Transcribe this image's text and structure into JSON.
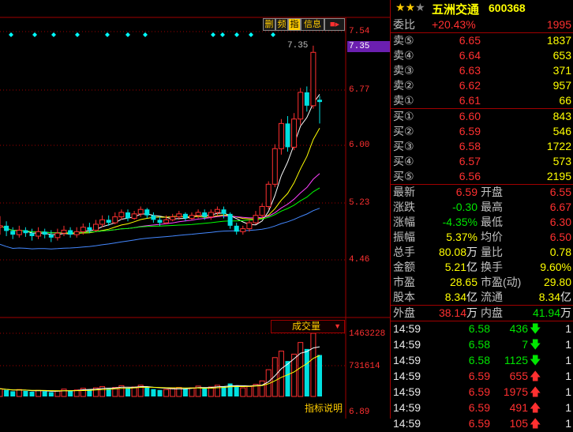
{
  "header": {
    "stars": 3,
    "stock_name": "五洲交通",
    "stock_code": "600368"
  },
  "toolbar": {
    "btn1": "删",
    "btn2": "频",
    "btn3": "指",
    "btn4": "信息"
  },
  "price_axis": {
    "ticks": [
      "7.54",
      "6.77",
      "6.00",
      "5.23",
      "4.46"
    ],
    "current": "7.35"
  },
  "chart_annotation": {
    "high_label": "7.35"
  },
  "volume_panel": {
    "title": "成交量",
    "ticks": [
      "1463228",
      "731614"
    ],
    "footer_label": "指标说明",
    "bottom_tick": "6.89"
  },
  "order_book": {
    "weibi_label": "委比",
    "weibi_pct": "+20.43%",
    "weibi_val": "1995",
    "asks": [
      {
        "label": "卖⑤",
        "price": "6.65",
        "qty": "1837"
      },
      {
        "label": "卖④",
        "price": "6.64",
        "qty": "653"
      },
      {
        "label": "卖③",
        "price": "6.63",
        "qty": "371"
      },
      {
        "label": "卖②",
        "price": "6.62",
        "qty": "957"
      },
      {
        "label": "卖①",
        "price": "6.61",
        "qty": "66"
      }
    ],
    "bids": [
      {
        "label": "买①",
        "price": "6.60",
        "qty": "843"
      },
      {
        "label": "买②",
        "price": "6.59",
        "qty": "546"
      },
      {
        "label": "买③",
        "price": "6.58",
        "qty": "1722"
      },
      {
        "label": "买④",
        "price": "6.57",
        "qty": "573"
      },
      {
        "label": "买⑤",
        "price": "6.56",
        "qty": "2195"
      }
    ]
  },
  "quote": [
    {
      "l1": "最新",
      "v1": "6.59",
      "u1": "",
      "l2": "开盘",
      "v2": "6.55"
    },
    {
      "l1": "涨跌",
      "v1": "-0.30",
      "u1": "",
      "l2": "最高",
      "v2": "6.67"
    },
    {
      "l1": "涨幅",
      "v1": "-4.35%",
      "u1": "",
      "l2": "最低",
      "v2": "6.30"
    },
    {
      "l1": "振幅",
      "v1": "5.37%",
      "u1": "",
      "l2": "均价",
      "v2": "6.50"
    },
    {
      "l1": "总手",
      "v1": "80.08",
      "u1": "万",
      "l2": "量比",
      "v2": "0.78"
    },
    {
      "l1": "金额",
      "v1": "5.21",
      "u1": "亿",
      "l2": "换手",
      "v2": "9.60%"
    },
    {
      "l1": "市盈",
      "v1": "28.65",
      "u1": "",
      "l2": "市盈(动)",
      "v2": "29.80"
    },
    {
      "l1": "股本",
      "v1": "8.34",
      "u1": "亿",
      "l2": "流通",
      "v2": "8.34",
      "u2": "亿"
    },
    {
      "l1": "外盘",
      "v1": "38.14",
      "u1": "万",
      "l2": "内盘",
      "v2": "41.94",
      "u2": "万"
    }
  ],
  "ticks": [
    {
      "time": "14:59",
      "price": "6.58",
      "vol": "436",
      "dir": "down",
      "n": "1"
    },
    {
      "time": "14:59",
      "price": "6.58",
      "vol": "7",
      "dir": "down",
      "n": "1"
    },
    {
      "time": "14:59",
      "price": "6.58",
      "vol": "1125",
      "dir": "down",
      "n": "1"
    },
    {
      "time": "14:59",
      "price": "6.59",
      "vol": "655",
      "dir": "up",
      "n": "1"
    },
    {
      "time": "14:59",
      "price": "6.59",
      "vol": "1975",
      "dir": "up",
      "n": "1"
    },
    {
      "time": "14:59",
      "price": "6.59",
      "vol": "491",
      "dir": "up",
      "n": "1"
    },
    {
      "time": "14:59",
      "price": "6.59",
      "vol": "105",
      "dir": "up",
      "n": "1"
    }
  ],
  "candles": [
    [
      4.9,
      4.92,
      4.8,
      5.05
    ],
    [
      4.92,
      4.85,
      4.78,
      4.98
    ],
    [
      4.85,
      4.8,
      4.74,
      4.9
    ],
    [
      4.8,
      4.86,
      4.76,
      4.92
    ],
    [
      4.86,
      4.82,
      4.77,
      4.9
    ],
    [
      4.82,
      4.78,
      4.72,
      4.88
    ],
    [
      4.78,
      4.84,
      4.74,
      4.9
    ],
    [
      4.84,
      4.8,
      4.75,
      4.88
    ],
    [
      4.8,
      4.76,
      4.7,
      4.86
    ],
    [
      4.76,
      4.82,
      4.72,
      4.88
    ],
    [
      4.82,
      4.86,
      4.78,
      4.92
    ],
    [
      4.86,
      4.8,
      4.76,
      4.9
    ],
    [
      4.8,
      4.84,
      4.76,
      4.9
    ],
    [
      4.84,
      4.9,
      4.8,
      4.95
    ],
    [
      4.9,
      4.86,
      4.82,
      4.96
    ],
    [
      4.86,
      4.94,
      4.84,
      5.0
    ],
    [
      4.94,
      5.0,
      4.9,
      5.06
    ],
    [
      5.0,
      4.96,
      4.92,
      5.06
    ],
    [
      4.96,
      5.04,
      4.94,
      5.1
    ],
    [
      5.04,
      5.1,
      5.0,
      5.14
    ],
    [
      5.1,
      5.02,
      4.98,
      5.14
    ],
    [
      5.02,
      5.08,
      5.0,
      5.12
    ],
    [
      5.08,
      5.14,
      5.04,
      5.18
    ],
    [
      5.14,
      5.06,
      5.02,
      5.16
    ],
    [
      5.06,
      5.0,
      4.96,
      5.1
    ],
    [
      5.0,
      4.96,
      4.92,
      5.04
    ],
    [
      4.96,
      5.0,
      4.94,
      5.06
    ],
    [
      5.0,
      5.04,
      4.98,
      5.08
    ],
    [
      5.04,
      5.08,
      5.0,
      5.12
    ],
    [
      5.08,
      5.02,
      4.98,
      5.1
    ],
    [
      5.02,
      5.06,
      5.0,
      5.1
    ],
    [
      5.06,
      5.1,
      5.02,
      5.14
    ],
    [
      5.1,
      5.04,
      5.0,
      5.14
    ],
    [
      5.04,
      5.1,
      5.0,
      5.14
    ],
    [
      5.1,
      5.14,
      5.06,
      5.18
    ],
    [
      5.14,
      5.08,
      5.02,
      5.18
    ],
    [
      5.08,
      4.92,
      4.88,
      5.1
    ],
    [
      4.92,
      4.84,
      4.8,
      4.96
    ],
    [
      4.84,
      4.88,
      4.8,
      4.92
    ],
    [
      4.88,
      4.96,
      4.84,
      5.0
    ],
    [
      4.96,
      5.06,
      4.94,
      5.12
    ],
    [
      5.06,
      5.18,
      5.02,
      5.22
    ],
    [
      5.18,
      5.48,
      5.14,
      5.52
    ],
    [
      5.48,
      5.96,
      5.44,
      6.02
    ],
    [
      5.96,
      6.3,
      5.88,
      6.36
    ],
    [
      6.3,
      5.98,
      5.92,
      6.4
    ],
    [
      5.98,
      6.36,
      5.94,
      6.44
    ],
    [
      6.36,
      6.72,
      6.28,
      6.78
    ],
    [
      6.72,
      6.54,
      6.46,
      6.8
    ],
    [
      6.54,
      7.26,
      6.5,
      7.35
    ],
    [
      6.62,
      6.59,
      6.3,
      6.67
    ]
  ],
  "volumes": [
    180,
    150,
    120,
    160,
    130,
    110,
    140,
    120,
    100,
    130,
    170,
    140,
    150,
    190,
    160,
    200,
    230,
    180,
    210,
    250,
    200,
    220,
    260,
    210,
    170,
    150,
    160,
    190,
    210,
    180,
    200,
    240,
    200,
    220,
    260,
    230,
    300,
    250,
    200,
    230,
    280,
    360,
    620,
    900,
    1050,
    820,
    980,
    1250,
    1100,
    1463,
    960
  ]
}
